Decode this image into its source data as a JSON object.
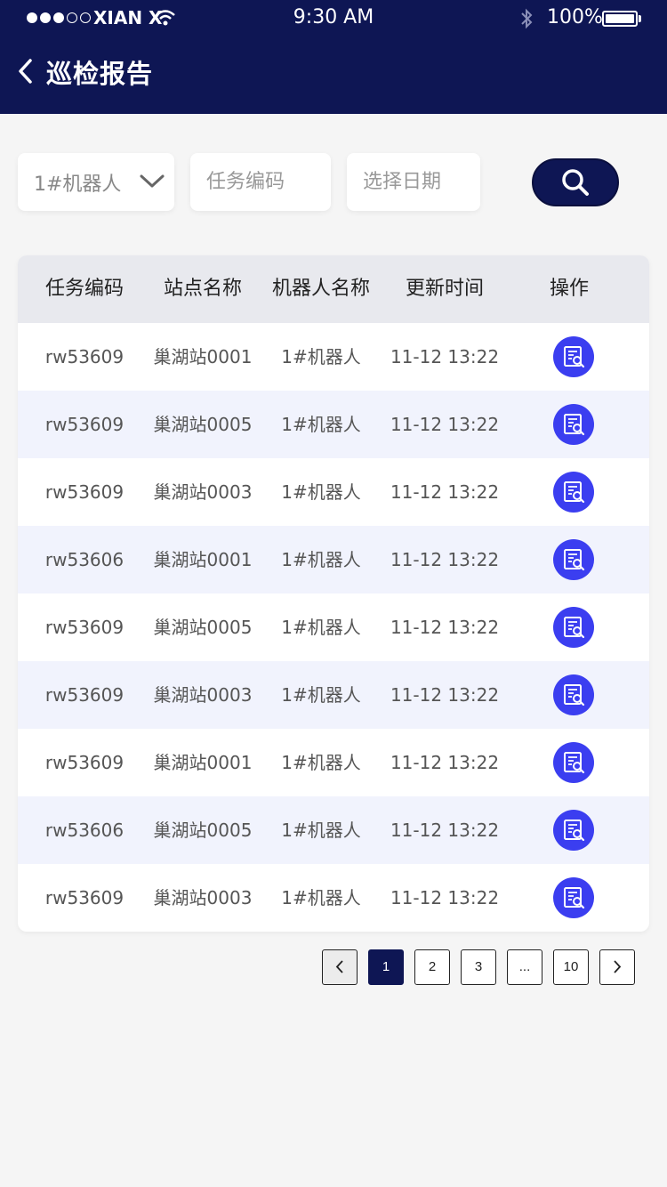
{
  "status_bar": {
    "carrier": "XIAN X",
    "time": "9:30 AM",
    "battery": "100%"
  },
  "nav": {
    "title": "巡检报告"
  },
  "filters": {
    "robot": "1#机器人",
    "task_placeholder": "任务编码",
    "date_placeholder": "选择日期"
  },
  "table": {
    "headers": [
      "任务编码",
      "站点名称",
      "机器人名称",
      "更新时间",
      "操作"
    ],
    "rows": [
      [
        "rw53609",
        "巢湖站0001",
        "1#机器人",
        "11-12 13:22"
      ],
      [
        "rw53609",
        "巢湖站0005",
        "1#机器人",
        "11-12 13:22"
      ],
      [
        "rw53609",
        "巢湖站0003",
        "1#机器人",
        "11-12 13:22"
      ],
      [
        "rw53606",
        "巢湖站0001",
        "1#机器人",
        "11-12 13:22"
      ],
      [
        "rw53609",
        "巢湖站0005",
        "1#机器人",
        "11-12 13:22"
      ],
      [
        "rw53609",
        "巢湖站0003",
        "1#机器人",
        "11-12 13:22"
      ],
      [
        "rw53609",
        "巢湖站0001",
        "1#机器人",
        "11-12 13:22"
      ],
      [
        "rw53606",
        "巢湖站0005",
        "1#机器人",
        "11-12 13:22"
      ],
      [
        "rw53609",
        "巢湖站0003",
        "1#机器人",
        "11-12 13:22"
      ]
    ]
  },
  "pagination": {
    "pages": [
      "1",
      "2",
      "3",
      "...",
      "10"
    ],
    "current": "1"
  },
  "colors": {
    "primary": "#0e1654",
    "accent": "#3b3ef0",
    "row_alt": "#f1f3fd"
  }
}
